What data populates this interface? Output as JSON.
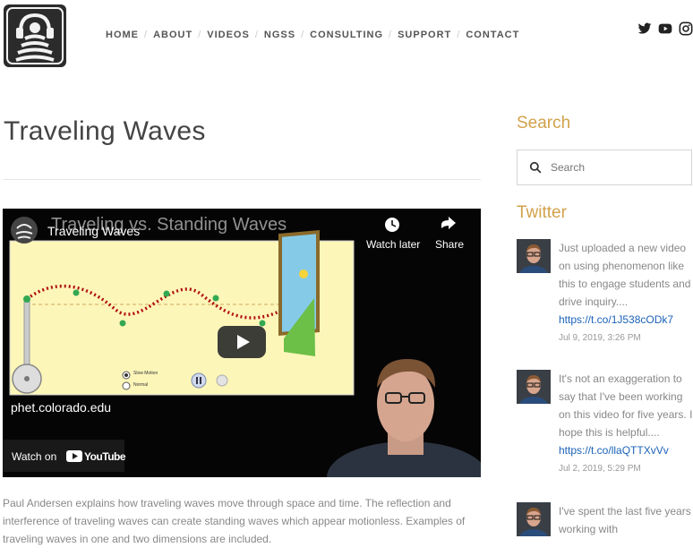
{
  "nav": {
    "items": [
      {
        "label": "HOME"
      },
      {
        "label": "ABOUT"
      },
      {
        "label": "VIDEOS"
      },
      {
        "label": "NGSS"
      },
      {
        "label": "CONSULTING"
      },
      {
        "label": "SUPPORT"
      },
      {
        "label": "CONTACT"
      }
    ],
    "separator": "/"
  },
  "social": [
    "twitter-icon",
    "youtube-icon",
    "instagram-icon"
  ],
  "page": {
    "title": "Traveling Waves",
    "description": "Paul Andersen explains how traveling waves move through space and time. The reflection and interference of traveling waves can create standing waves which appear motionless. Examples of traveling waves in one and two dimensions are included."
  },
  "video": {
    "bg_title": "Traveling vs. Standing Waves",
    "title": "Traveling Waves",
    "watch_later": "Watch later",
    "share": "Share",
    "url_text": "phet.colorado.edu",
    "watch_on": "Watch on",
    "youtube": "YouTube",
    "sim_radio_1": "Slow Motion",
    "sim_radio_2": "Normal"
  },
  "sidebar": {
    "search_heading": "Search",
    "search_placeholder": "Search",
    "twitter_heading": "Twitter",
    "tweets": [
      {
        "text": "Just uploaded a new video on using phenomenon like this to engage students and drive inquiry....",
        "link": "https://t.co/1J538cODk7",
        "date": "Jul 9, 2019, 3:26 PM"
      },
      {
        "text": "It's not an exaggeration to say that I've been working on this video for five years. I hope this is helpful....",
        "link": "https://t.co/llaQTTXvVv",
        "date": "Jul 2, 2019, 5:29 PM"
      },
      {
        "text": "I've spent the last five years working with",
        "link": "",
        "date": ""
      }
    ]
  },
  "colors": {
    "accent": "#d1a24a",
    "link": "#1b62b8"
  }
}
